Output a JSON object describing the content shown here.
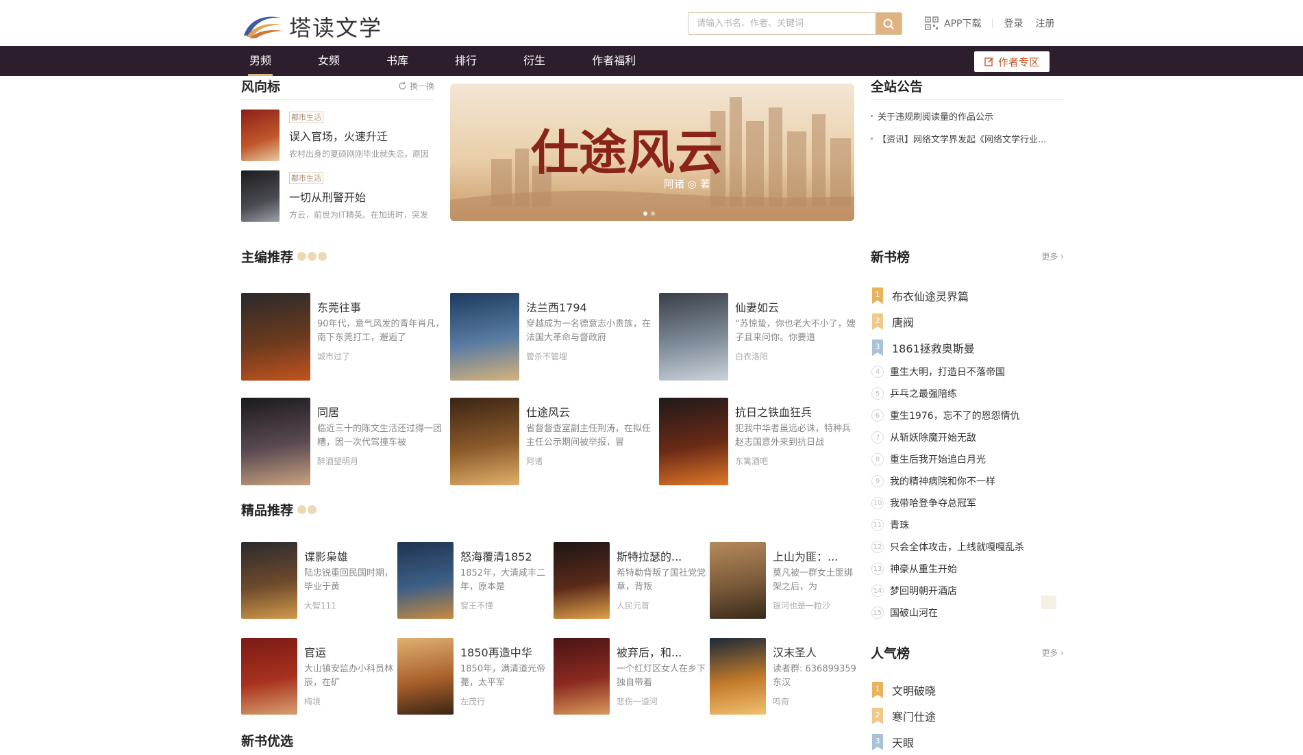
{
  "header": {
    "logo_text": "塔读文学",
    "search_placeholder": "请输入书名、作者、关键词",
    "app_download": "APP下载",
    "login": "登录",
    "register": "注册"
  },
  "nav": {
    "items": [
      "男频",
      "女频",
      "书库",
      "排行",
      "衍生",
      "作者福利"
    ],
    "author_zone": "作者专区"
  },
  "wind": {
    "title": "风向标",
    "refresh": "换一换",
    "items": [
      {
        "tag": "都市生活",
        "name": "误入官场，火速升迁",
        "desc": "农村出身的夏硕刚刚毕业就失恋，原因"
      },
      {
        "tag": "都市生活",
        "name": "一切从刑警开始",
        "desc": "方云，前世为IT精英。在加班时，突发"
      }
    ]
  },
  "banner": {
    "title": "仕途风云",
    "author": "阿诸 ◎ 著"
  },
  "notice": {
    "title": "全站公告",
    "items": [
      "关于违规刷阅读量的作品公示",
      "【资讯】网络文学界发起《网络文学行业..."
    ]
  },
  "editor": {
    "title": "主编推荐",
    "books": [
      {
        "name": "东莞往事",
        "desc": "90年代，意气风发的青年肖凡，南下东莞打工，邂逅了",
        "author": "城市过了"
      },
      {
        "name": "法兰西1794",
        "desc": "穿越成为一名德意志小贵族，在法国大革命与督政府",
        "author": "管杀不管埋"
      },
      {
        "name": "仙妻如云",
        "desc": "“苏惊蛰，你也老大不小了，嫂子且来问你。你要道",
        "author": "白衣洛阳"
      },
      {
        "name": "同居",
        "desc": "临近三十的陈文生活还过得一团糟，因一次代驾撞车被",
        "author": "醉酒望明月"
      },
      {
        "name": "仕途风云",
        "desc": "省督督查室副主任荆涛，在拟任主任公示期间被举报，冒",
        "author": "阿诸"
      },
      {
        "name": "抗日之铁血狂兵",
        "desc": "犯我中华者虽远必诛，特种兵赵志国意外来到抗日战",
        "author": "东篱酒吧"
      }
    ]
  },
  "premium": {
    "title": "精品推荐",
    "books": [
      {
        "name": "谍影枭雄",
        "desc": "陆忠锐重回民国时期，毕业于黄",
        "author": "大智111"
      },
      {
        "name": "怒海覆清1852",
        "desc": "1852年，大清咸丰二年，原本是",
        "author": "窗王不懂"
      },
      {
        "name": "斯特拉瑟的...",
        "desc": "希特勒背叛了国社党党章，背叛",
        "author": "人民元首"
      },
      {
        "name": "上山为匪：...",
        "desc": "莫凡被一群女土匪绑架之后，为",
        "author": "银河也是一粒沙"
      },
      {
        "name": "官运",
        "desc": "大山镇安监办小科员林辰，在矿",
        "author": "梅境"
      },
      {
        "name": "1850再造中华",
        "desc": "1850年，满清道光帝薨，太平军",
        "author": "左茂行"
      },
      {
        "name": "被弃后，和...",
        "desc": "一个红灯区女人在乡下独自带着",
        "author": "悲伤一道河"
      },
      {
        "name": "汉末圣人",
        "desc": "读者群: 636899359 东汉",
        "author": "鸣奇"
      }
    ]
  },
  "newrank": {
    "title": "新书榜",
    "more": "更多",
    "items": [
      "布衣仙途灵界篇",
      "唐阀",
      "1861拯救奥斯曼",
      "重生大明，打造日不落帝国",
      "乒乓之最强陪练",
      "重生1976，忘不了的恩怨情仇",
      "从斩妖除魔开始无敌",
      "重生后我开始追白月光",
      "我的精神病院和你不一样",
      "我带哈登争夺总冠军",
      "青珠",
      "只会全体攻击，上线就嘎嘎乱杀",
      "神豪从重生开始",
      "梦回明朝开酒店",
      "国破山河在"
    ],
    "nums": [
      "4",
      "5",
      "6",
      "7",
      "8",
      "9",
      "10",
      "11",
      "12",
      "13",
      "14",
      "15"
    ]
  },
  "poprank": {
    "title": "人气榜",
    "more": "更多",
    "items": [
      "文明破晓",
      "寒门仕途",
      "天眼"
    ]
  },
  "newbook": {
    "title": "新书优选"
  }
}
